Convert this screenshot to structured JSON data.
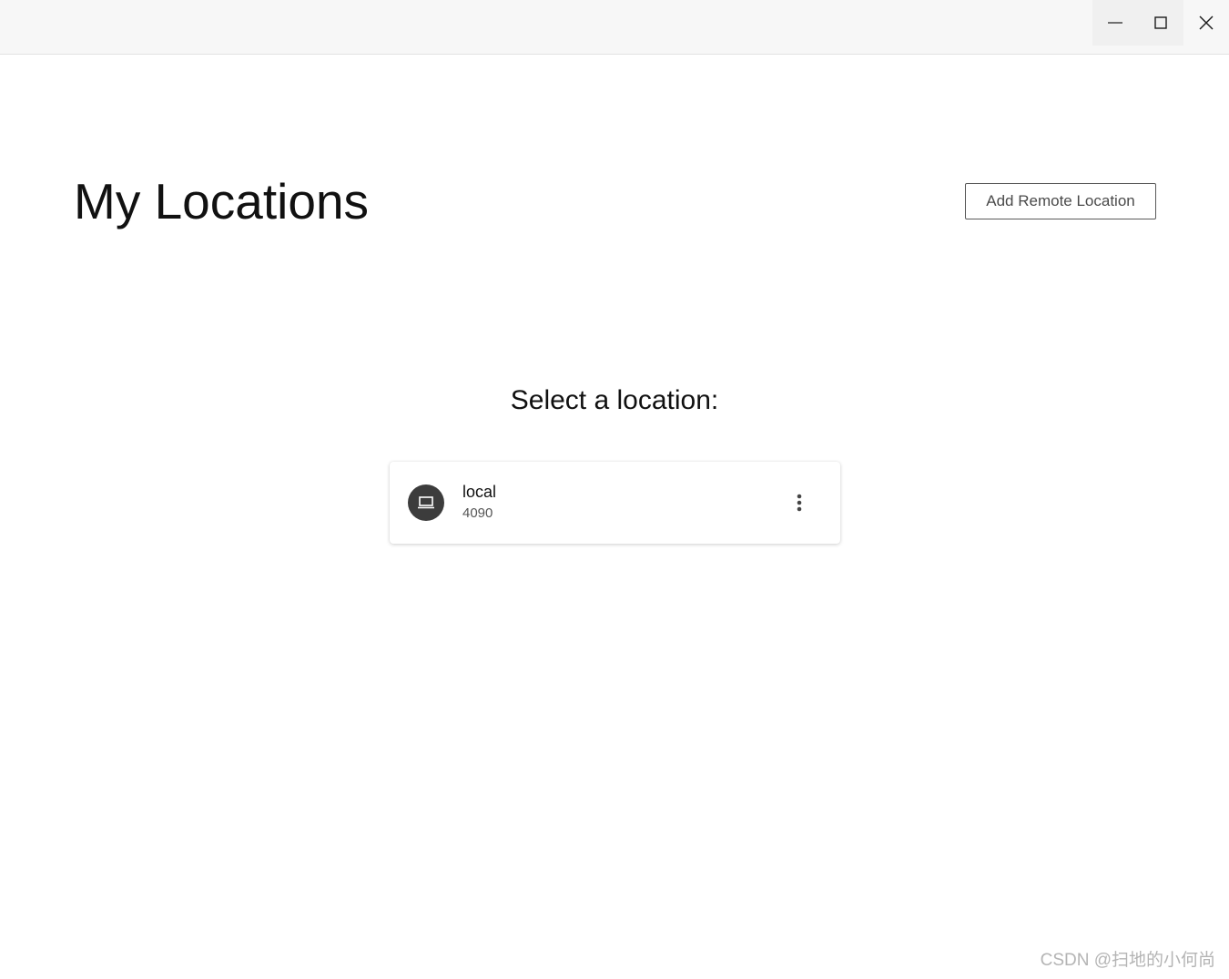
{
  "window": {
    "controls": {
      "minimize": "minimize-icon",
      "maximize": "maximize-icon",
      "close": "close-icon"
    }
  },
  "header": {
    "title": "My Locations",
    "add_remote_label": "Add Remote Location"
  },
  "main": {
    "heading": "Select a location:",
    "locations": [
      {
        "name": "local",
        "subtitle": "4090",
        "icon": "laptop-icon",
        "menu_icon": "more-vertical-icon"
      }
    ]
  },
  "watermark": "CSDN @扫地的小何尚",
  "colors": {
    "avatar_bg": "#3c3c3c",
    "button_border": "#5a5a5a",
    "titlebar_bg": "#f7f7f7"
  }
}
